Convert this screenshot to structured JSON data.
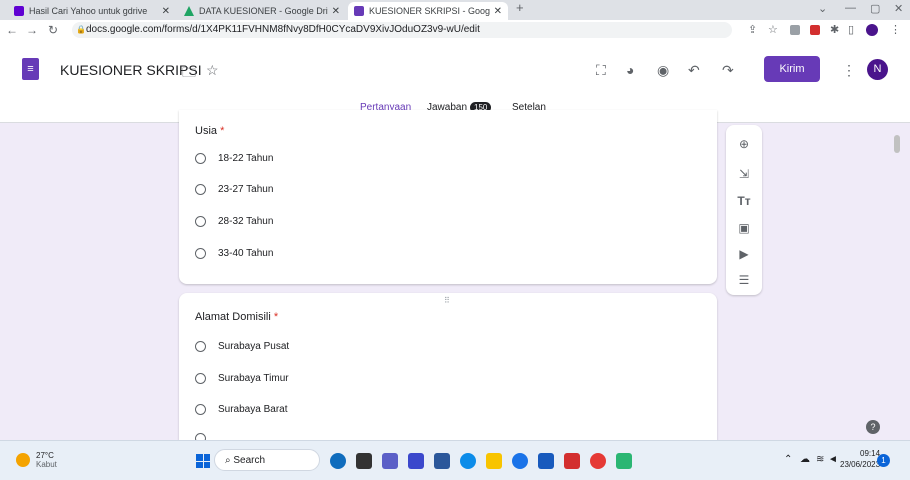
{
  "browser": {
    "tabs": [
      {
        "label": "Hasil Cari Yahoo untuk gdrive",
        "favicon_color": "#6001d2"
      },
      {
        "label": "DATA KUESIONER - Google Drive",
        "favicon_color": "#1fa463"
      },
      {
        "label": "KUESIONER SKRIPSI - Google Fo",
        "favicon_color": "#673ab7"
      }
    ],
    "new_tab": "+",
    "url": "docs.google.com/forms/d/1X4PK11FVHNM8fNvy8DfH0CYcaDV9XivJOduOZ3v9-wU/edit"
  },
  "form": {
    "title": "KUESIONER SKRIPSI",
    "send_label": "Kirim",
    "avatar": "N",
    "tabs": {
      "questions": "Pertanyaan",
      "responses": "Jawaban",
      "responses_count": "150",
      "settings": "Setelan"
    },
    "question1": {
      "title": "Usia",
      "required": "*",
      "options": [
        "18-22 Tahun",
        "23-27 Tahun",
        "28-32 Tahun",
        "33-40 Tahun"
      ]
    },
    "question2": {
      "title": "Alamat Domisili",
      "required": "*",
      "options": [
        "Surabaya Pusat",
        "Surabaya Timur",
        "Surabaya Barat"
      ]
    },
    "accent_color": "#673ab7",
    "background_color": "#f0ebf8"
  },
  "taskbar": {
    "temperature": "27°C",
    "weather": "Kabut",
    "search_label": "Search",
    "time": "09:14",
    "date": "23/06/2023",
    "notification_count": "1"
  }
}
